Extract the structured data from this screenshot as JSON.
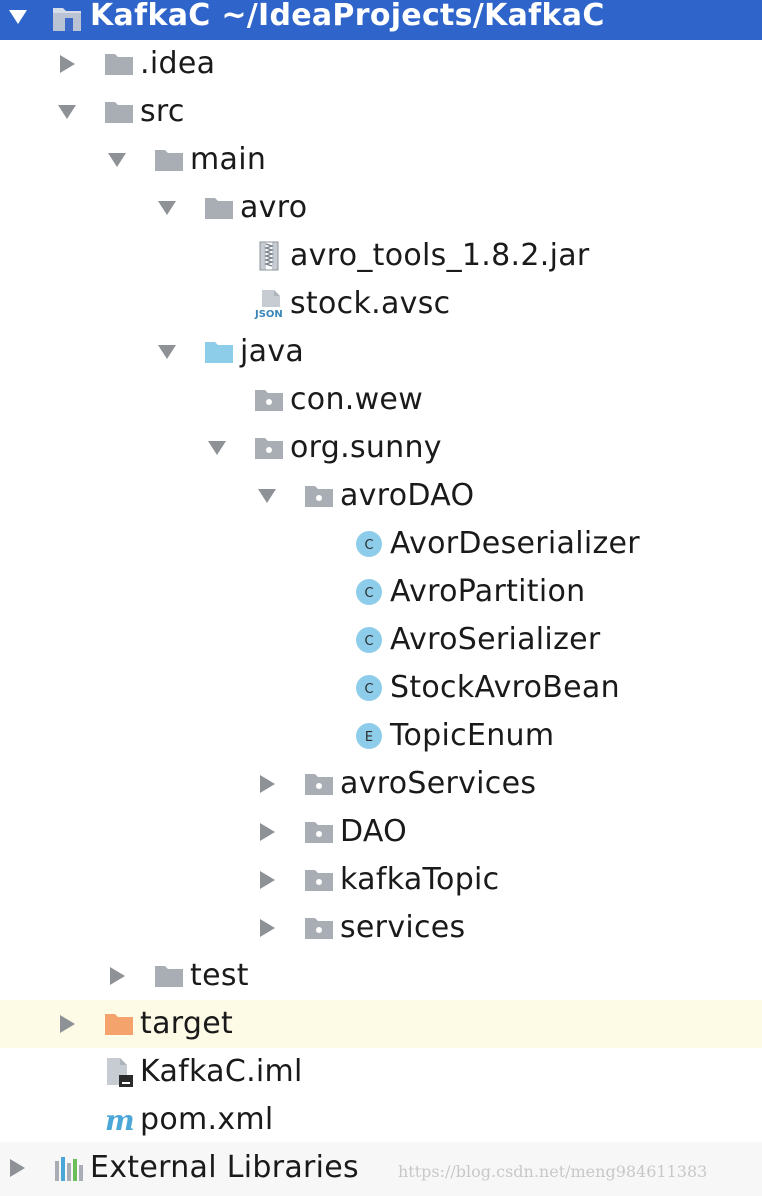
{
  "project": {
    "name": "KafkaC",
    "path": "~/IdeaProjects/KafkaC"
  },
  "tree": {
    "idea": ".idea",
    "src": "src",
    "main": "main",
    "avro": "avro",
    "avro_tools_jar": "avro_tools_1.8.2.jar",
    "stock_avsc": "stock.avsc",
    "java": "java",
    "con_wew": "con.wew",
    "org_sunny": "org.sunny",
    "avroDAO": "avroDAO",
    "classes": [
      {
        "name": "AvorDeserializer",
        "kind": "C"
      },
      {
        "name": "AvroPartition",
        "kind": "C"
      },
      {
        "name": "AvroSerializer",
        "kind": "C"
      },
      {
        "name": "StockAvroBean",
        "kind": "C"
      },
      {
        "name": "TopicEnum",
        "kind": "E"
      }
    ],
    "avroServices": "avroServices",
    "DAO": "DAO",
    "kafkaTopic": "kafkaTopic",
    "services": "services",
    "test": "test",
    "target": "target",
    "iml": "KafkaC.iml",
    "pom": "pom.xml",
    "external": "External Libraries"
  },
  "icons": {
    "json_badge": "JSON",
    "maven_badge": "m"
  },
  "watermark": "https://blog.csdn.net/meng984611383",
  "colors": {
    "selection": "#2f65ca",
    "folder": "#a9aeb5",
    "source_folder": "#8ecdea",
    "excluded_folder": "#f5a36c",
    "class_icon": "#8ecdea",
    "highlight_row": "#fdfbe6"
  }
}
